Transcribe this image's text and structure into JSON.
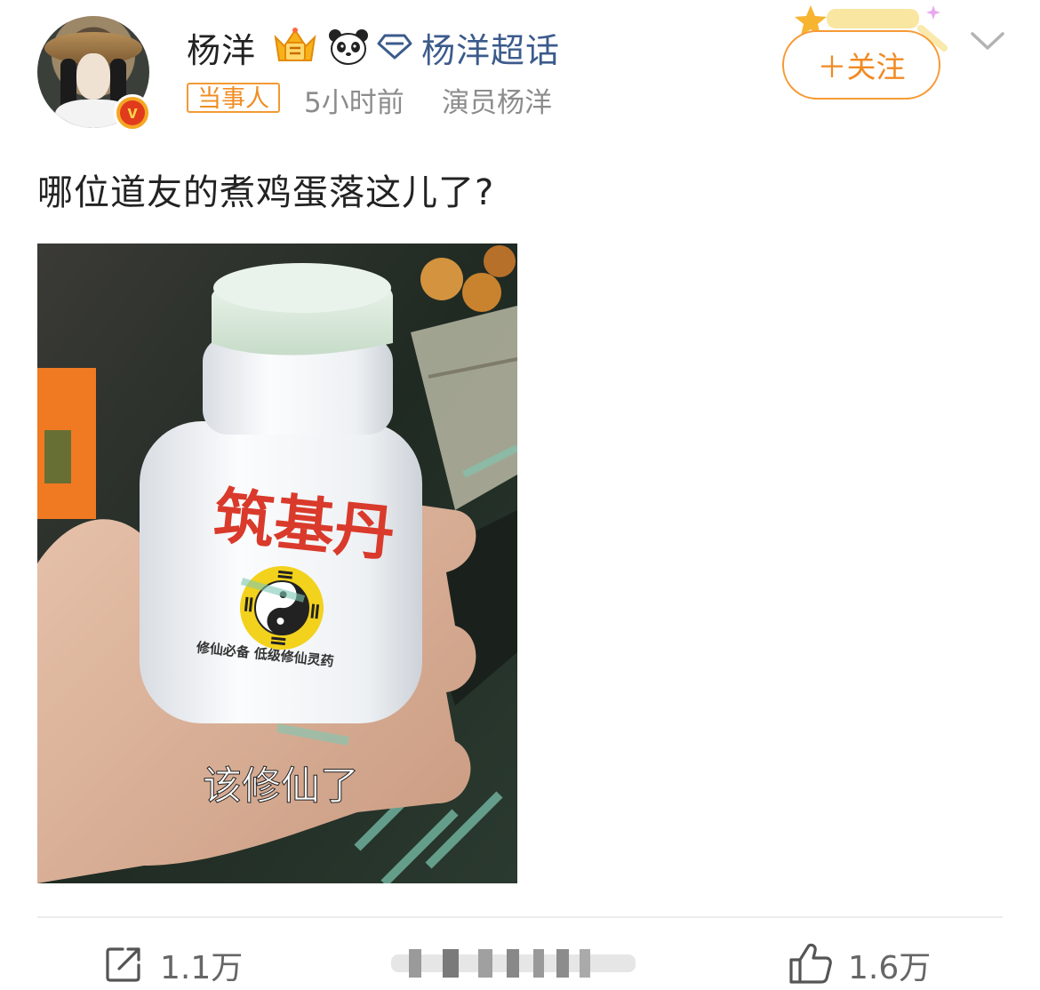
{
  "header": {
    "username": "杨洋",
    "supertopic_label": "杨洋超话",
    "tag_label": "当事人",
    "time": "5小时前",
    "source": "演员杨洋",
    "follow_label": "＋关注",
    "icons": [
      "crown-badge-icon",
      "panda-badge-icon",
      "diamond-icon",
      "verified-v-icon",
      "chevron-down-icon"
    ]
  },
  "post": {
    "text": "哪位道友的煮鸡蛋落这儿了?",
    "image": {
      "bottle_label": "筑基丹",
      "bottle_small_text": "修仙必备  低级修仙灵药",
      "caption": "该修仙了"
    }
  },
  "footer": {
    "share_count": "1.1万",
    "like_count": "1.6万",
    "icons": [
      "share-icon",
      "like-icon"
    ]
  },
  "colors": {
    "accent_orange": "#f08a22",
    "supertopic_blue": "#3c5b8c",
    "meta_gray": "#8c8c8c",
    "bottle_red": "#d93a2b",
    "taiji_yellow": "#f2d21c"
  }
}
